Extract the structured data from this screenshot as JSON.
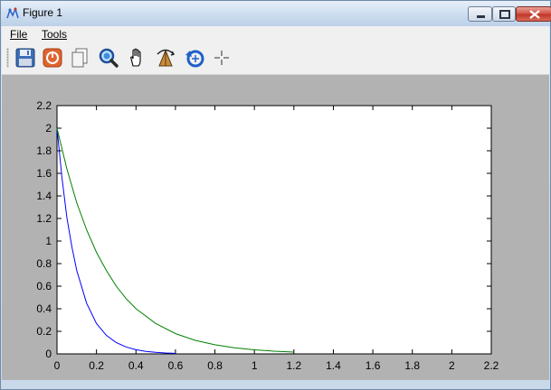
{
  "window": {
    "title": "Figure 1"
  },
  "menu": {
    "file_label": "File",
    "tools_label": "Tools"
  },
  "toolbar": {
    "icons": [
      "save-icon",
      "stop-icon",
      "copy-icon",
      "zoom-icon",
      "pan-hand-icon",
      "rotate-3d-icon",
      "reset-view-icon",
      "crosshair-icon"
    ]
  },
  "colors": {
    "series_blue": "#0000ff",
    "series_green": "#008000",
    "figure_bg": "#b2b2b2"
  },
  "chart_data": {
    "type": "line",
    "title": "",
    "xlabel": "",
    "ylabel": "",
    "xlim": [
      0,
      2.2
    ],
    "ylim": [
      0,
      2.2
    ],
    "xticks": [
      "0",
      "0.2",
      "0.4",
      "0.6",
      "0.8",
      "1",
      "1.2",
      "1.4",
      "1.6",
      "1.8",
      "2",
      "2.2"
    ],
    "yticks": [
      "0",
      "0.2",
      "0.4",
      "0.6",
      "0.8",
      "1",
      "1.2",
      "1.4",
      "1.6",
      "1.8",
      "2",
      "2.2"
    ],
    "grid": false,
    "series": [
      {
        "color": "#0000ff",
        "x": [
          0,
          0.025,
          0.05,
          0.075,
          0.1,
          0.15,
          0.2,
          0.25,
          0.3,
          0.35,
          0.4,
          0.45,
          0.5,
          0.55,
          0.6
        ],
        "y": [
          2.0,
          1.56,
          1.21,
          0.95,
          0.74,
          0.45,
          0.27,
          0.165,
          0.1,
          0.062,
          0.037,
          0.022,
          0.014,
          0.008,
          0.005
        ]
      },
      {
        "color": "#008000",
        "x": [
          0,
          0.05,
          0.1,
          0.15,
          0.2,
          0.25,
          0.3,
          0.35,
          0.4,
          0.5,
          0.6,
          0.7,
          0.8,
          0.9,
          1.0,
          1.1,
          1.2
        ],
        "y": [
          2.0,
          1.64,
          1.34,
          1.1,
          0.9,
          0.74,
          0.6,
          0.49,
          0.4,
          0.27,
          0.18,
          0.12,
          0.081,
          0.054,
          0.036,
          0.024,
          0.016
        ]
      }
    ]
  }
}
